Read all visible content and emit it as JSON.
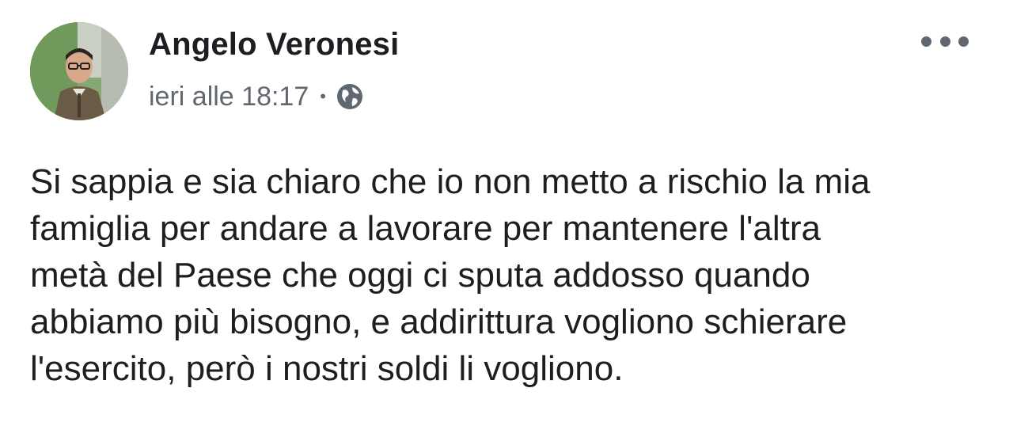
{
  "post": {
    "author_name": "Angelo Veronesi",
    "timestamp": "ieri alle 18:17",
    "separator": "•",
    "audience_icon": "globe-icon",
    "more_icon": "more-options-icon",
    "text_lines": [
      "Si sappia e sia chiaro che io non metto a rischio la mia",
      "famiglia per andare a lavorare per mantenere l'altra",
      "metà del Paese che oggi ci sputa addosso quando",
      "abbiamo più bisogno, e addirittura vogliono schierare",
      "l'esercito, però i nostri soldi li vogliono."
    ]
  },
  "colors": {
    "text_primary": "#1c1e21",
    "text_secondary": "#606770",
    "background": "#ffffff"
  }
}
